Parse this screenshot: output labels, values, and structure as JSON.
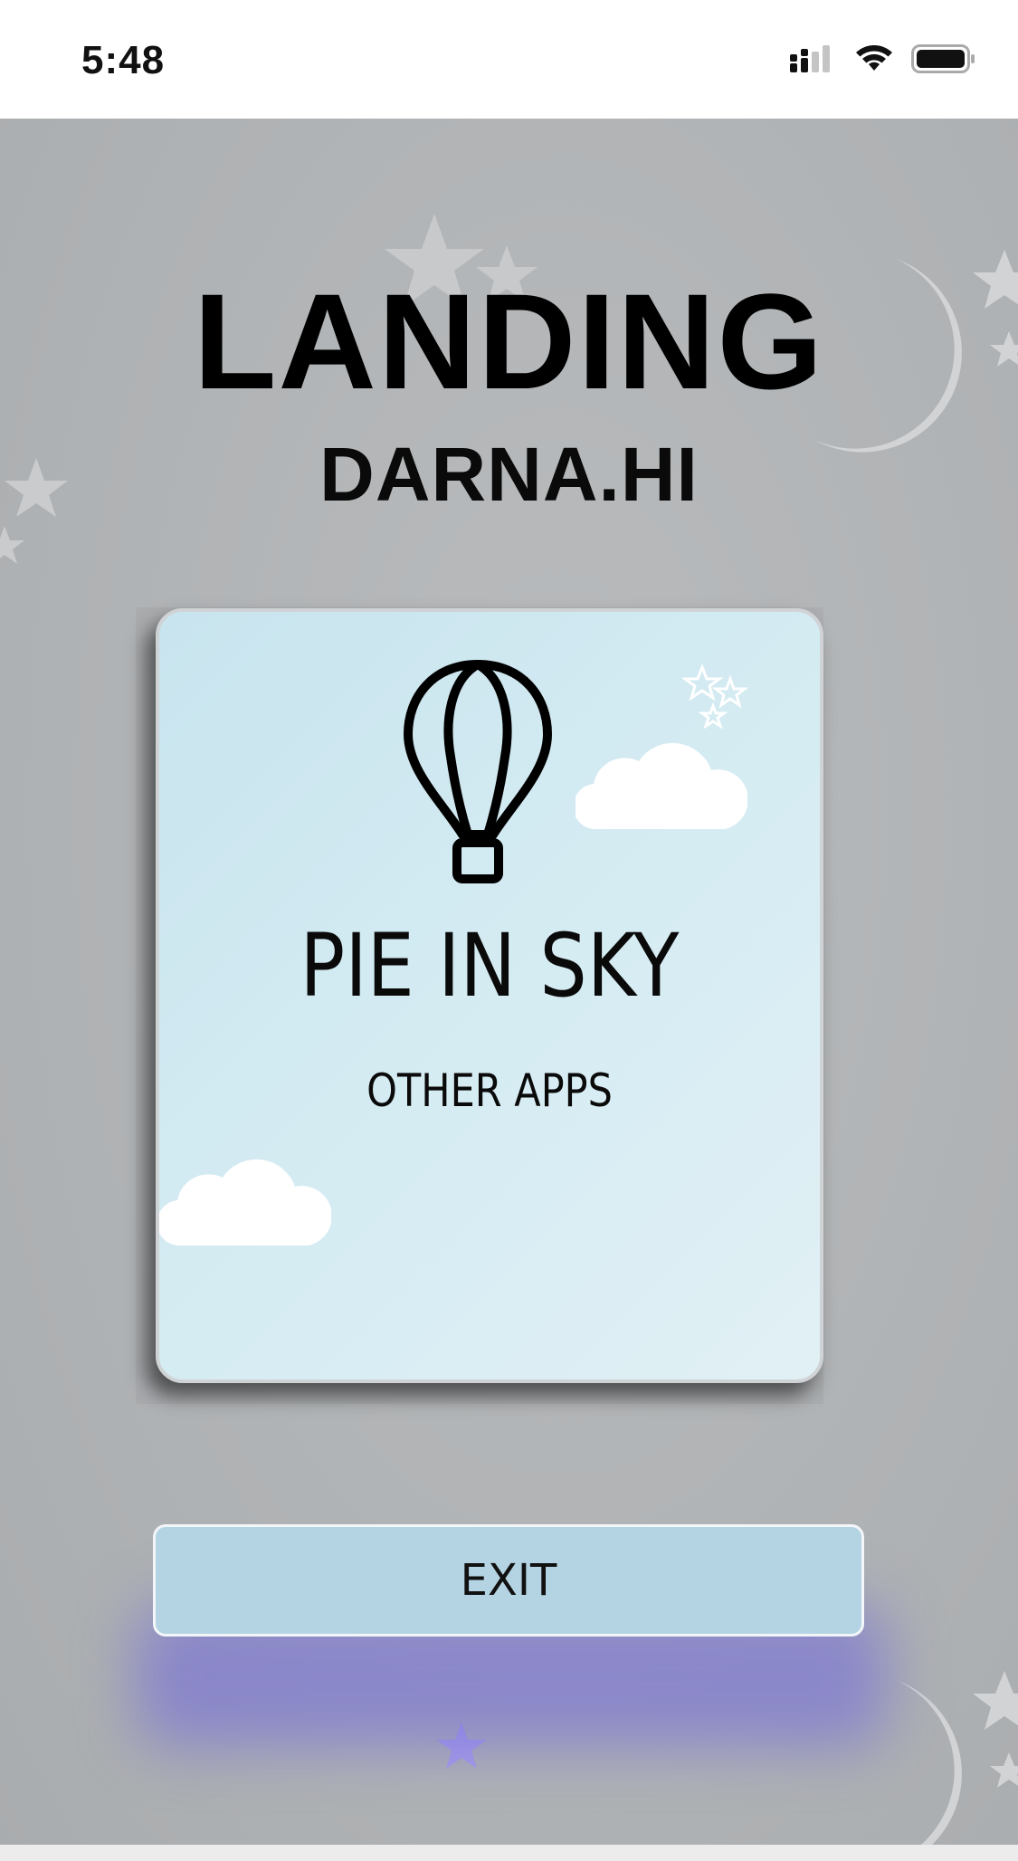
{
  "status_bar": {
    "time": "5:48",
    "icons": [
      "cellular-signal-icon",
      "wifi-icon",
      "battery-icon"
    ]
  },
  "landing": {
    "title": "LANDING",
    "subtitle": "DARNA.HI"
  },
  "app_card": {
    "icon": "hot-air-balloon-icon",
    "name": "PIE IN SKY",
    "link_label": "OTHER APPS"
  },
  "exit": {
    "label": "EXIT"
  },
  "colors": {
    "background": "#b3b6b8",
    "card_background": "#d6ecf3",
    "exit_button": "#b4d4e4",
    "exit_glow": "#6e64dc"
  }
}
